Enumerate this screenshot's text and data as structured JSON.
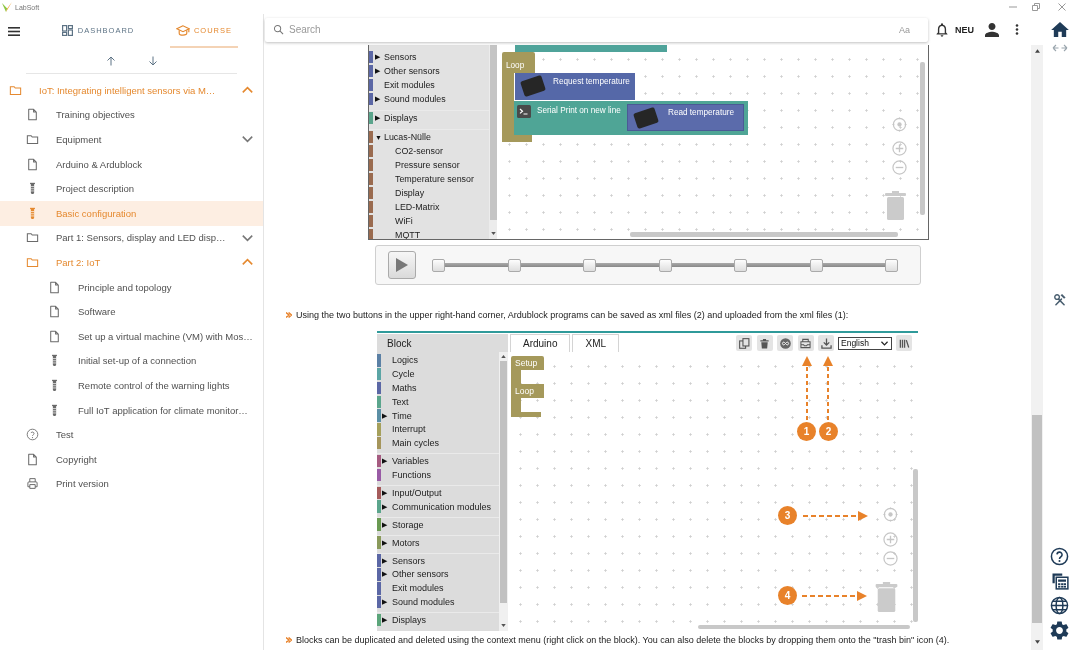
{
  "title_bar": {
    "app_name": "LabSoft"
  },
  "sidebar": {
    "tabs": [
      {
        "kind": "dashboard",
        "label": "DASHBOARD",
        "selected": false
      },
      {
        "kind": "course",
        "label": "COURSE",
        "selected": true
      }
    ],
    "tree": [
      {
        "kind": "folder",
        "label": "IoT: Integrating intelligent sensors via M…",
        "expanded": true,
        "selected": false,
        "children": [
          {
            "kind": "page",
            "label": "Training objectives",
            "selected": false
          },
          {
            "kind": "folder",
            "label": "Equipment",
            "expanded": false,
            "selected": false
          },
          {
            "kind": "page",
            "label": "Arduino & Ardublock",
            "selected": false
          },
          {
            "kind": "experiment",
            "label": "Project description",
            "selected": false
          },
          {
            "kind": "experiment",
            "label": "Basic configuration",
            "selected": true
          },
          {
            "kind": "folder",
            "label": "Part 1: Sensors, display and LED disp…",
            "expanded": false,
            "selected": false
          },
          {
            "kind": "folder",
            "label": "Part 2: IoT",
            "expanded": true,
            "selected": false,
            "children": [
              {
                "kind": "page",
                "label": "Principle and topology",
                "selected": false
              },
              {
                "kind": "page",
                "label": "Software",
                "selected": false
              },
              {
                "kind": "page",
                "label": "Set up a virtual machine (VM) with Mos…",
                "selected": false
              },
              {
                "kind": "experiment",
                "label": "Initial set-up of a connection",
                "selected": false
              },
              {
                "kind": "experiment",
                "label": "Remote control of the warning lights",
                "selected": false
              },
              {
                "kind": "experiment",
                "label": "Full IoT application for climate monitor…",
                "selected": false
              }
            ]
          },
          {
            "kind": "test",
            "label": "Test",
            "selected": false
          },
          {
            "kind": "page",
            "label": "Copyright",
            "selected": false
          },
          {
            "kind": "print",
            "label": "Print version",
            "selected": false
          }
        ]
      }
    ]
  },
  "top_bar": {
    "search": {
      "placeholder": "Search",
      "match_case": "Aa"
    },
    "badge": "NEU"
  },
  "content": {
    "figure_1": {
      "palette": [
        {
          "items": [
            {
              "label": "Sensors",
              "arrow": "▶",
              "color": "#5b67a5"
            },
            {
              "label": "Other sensors",
              "arrow": "▶",
              "color": "#5b67a5"
            },
            {
              "label": "Exit modules",
              "color": "#5b67a5"
            },
            {
              "label": "Sound modules",
              "arrow": "▶",
              "color": "#5b67a5"
            }
          ]
        },
        {
          "items": [
            {
              "label": "Displays",
              "arrow": "▶",
              "color": "#5ba58c"
            }
          ]
        },
        {
          "items": [
            {
              "label": "Lucas-Nülle",
              "arrow": "▼",
              "color": "#9a6b4f",
              "children": [
                {
                  "label": "CO2-sensor"
                },
                {
                  "label": "Pressure sensor"
                },
                {
                  "label": "Temperature sensor"
                },
                {
                  "label": "Display"
                },
                {
                  "label": "LED-Matrix"
                },
                {
                  "label": "WiFi"
                },
                {
                  "label": "MQTT"
                }
              ]
            }
          ]
        }
      ],
      "blocks": {
        "loop": "Loop",
        "request": "Request temperature",
        "serial_print": "Serial Print on new line",
        "read": "Read temperature"
      }
    },
    "instruction_1": "Using the two buttons in the upper right-hand corner, Ardublock programs can be saved as xml files (2) and uploaded from the xml files (1):",
    "figure_2": {
      "palette_header": "Block",
      "tabs": [
        "Arduino",
        "XML"
      ],
      "language": "English",
      "palette": [
        {
          "items": [
            {
              "label": "Logics",
              "color": "#5b80a5"
            },
            {
              "label": "Cycle",
              "color": "#5ba5a5"
            },
            {
              "label": "Maths",
              "color": "#5b67a5"
            },
            {
              "label": "Text",
              "color": "#5ba58c"
            },
            {
              "label": "Time",
              "arrow": "▶",
              "color": "#5b8fa5"
            },
            {
              "label": "Interrupt",
              "color": "#a5a05b"
            },
            {
              "label": "Main cycles",
              "color": "#a5955b"
            }
          ]
        },
        {
          "items": [
            {
              "label": "Variables",
              "arrow": "▶",
              "color": "#a55b80"
            },
            {
              "label": "Functions",
              "color": "#995ba5"
            }
          ]
        },
        {
          "items": [
            {
              "label": "Input/Output",
              "arrow": "▶",
              "color": "#a55b5b"
            },
            {
              "label": "Communication modules",
              "arrow": "▶",
              "color": "#5ba58c"
            }
          ]
        },
        {
          "items": [
            {
              "label": "Storage",
              "arrow": "▶",
              "color": "#6a9a52"
            }
          ]
        },
        {
          "items": [
            {
              "label": "Motors",
              "arrow": "▶",
              "color": "#8a9a5b"
            }
          ]
        },
        {
          "items": [
            {
              "label": "Sensors",
              "arrow": "▶",
              "color": "#5b67a5"
            },
            {
              "label": "Other sensors",
              "arrow": "▶",
              "color": "#5b67a5"
            },
            {
              "label": "Exit modules",
              "color": "#5b67a5"
            },
            {
              "label": "Sound modules",
              "arrow": "▶",
              "color": "#5b67a5"
            }
          ]
        },
        {
          "items": [
            {
              "label": "Displays",
              "arrow": "▶",
              "color": "#5ba57a"
            }
          ]
        }
      ],
      "blocks": {
        "setup": "Setup",
        "loop": "Loop"
      },
      "callouts": [
        {
          "number": "1",
          "kind": "up"
        },
        {
          "number": "2",
          "kind": "up"
        },
        {
          "number": "3",
          "kind": "right"
        },
        {
          "number": "4",
          "kind": "right"
        }
      ]
    },
    "instruction_2": "Blocks can be duplicated and deleted using the context menu (right click on the block). You can also delete the blocks by dropping them onto the \"trash bin\" icon (4)."
  }
}
